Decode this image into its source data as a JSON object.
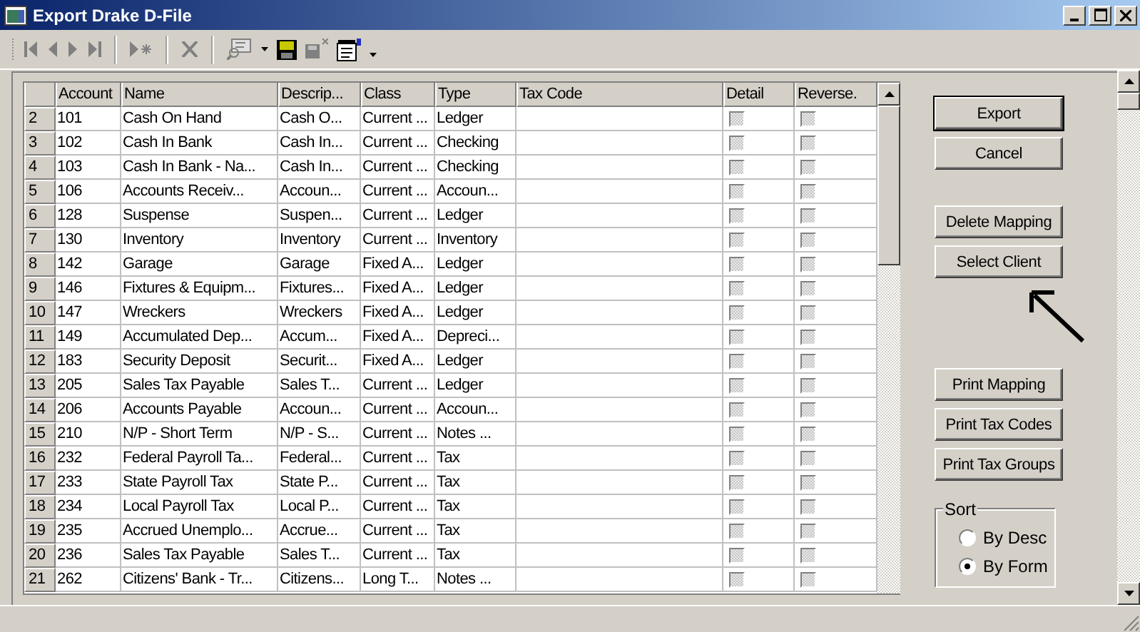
{
  "window": {
    "title": "Export Drake D-File"
  },
  "grid": {
    "columns": [
      "Account",
      "Name",
      "Descrip...",
      "Class",
      "Type",
      "Tax Code",
      "Detail",
      "Reverse."
    ],
    "rows": [
      {
        "num": "2",
        "account": "101",
        "name": "Cash On Hand",
        "description": "Cash O...",
        "class": "Current ...",
        "type": "Ledger",
        "detail": false,
        "reverse": false
      },
      {
        "num": "3",
        "account": "102",
        "name": "Cash In Bank",
        "description": "Cash In...",
        "class": "Current ...",
        "type": "Checking",
        "detail": false,
        "reverse": false
      },
      {
        "num": "4",
        "account": "103",
        "name": "Cash In Bank - Na...",
        "description": "Cash In...",
        "class": "Current ...",
        "type": "Checking",
        "detail": false,
        "reverse": false
      },
      {
        "num": "5",
        "account": "106",
        "name": "Accounts Receiv...",
        "description": "Accoun...",
        "class": "Current ...",
        "type": "Accoun...",
        "detail": false,
        "reverse": false
      },
      {
        "num": "6",
        "account": "128",
        "name": "Suspense",
        "description": "Suspen...",
        "class": "Current ...",
        "type": "Ledger",
        "detail": false,
        "reverse": false
      },
      {
        "num": "7",
        "account": "130",
        "name": "Inventory",
        "description": "Inventory",
        "class": "Current ...",
        "type": "Inventory",
        "detail": false,
        "reverse": false
      },
      {
        "num": "8",
        "account": "142",
        "name": "Garage",
        "description": "Garage",
        "class": "Fixed A...",
        "type": "Ledger",
        "detail": false,
        "reverse": false
      },
      {
        "num": "9",
        "account": "146",
        "name": "Fixtures & Equipm...",
        "description": "Fixtures...",
        "class": "Fixed A...",
        "type": "Ledger",
        "detail": false,
        "reverse": false
      },
      {
        "num": "10",
        "account": "147",
        "name": "Wreckers",
        "description": "Wreckers",
        "class": "Fixed A...",
        "type": "Ledger",
        "detail": false,
        "reverse": false
      },
      {
        "num": "11",
        "account": "149",
        "name": "Accumulated Dep...",
        "description": "Accum...",
        "class": "Fixed A...",
        "type": "Depreci...",
        "detail": false,
        "reverse": false
      },
      {
        "num": "12",
        "account": "183",
        "name": "Security Deposit",
        "description": "Securit...",
        "class": "Fixed A...",
        "type": "Ledger",
        "detail": false,
        "reverse": false
      },
      {
        "num": "13",
        "account": "205",
        "name": "Sales Tax Payable",
        "description": "Sales T...",
        "class": "Current ...",
        "type": "Ledger",
        "detail": false,
        "reverse": false
      },
      {
        "num": "14",
        "account": "206",
        "name": "Accounts Payable",
        "description": "Accoun...",
        "class": "Current ...",
        "type": "Accoun...",
        "detail": false,
        "reverse": false
      },
      {
        "num": "15",
        "account": "210",
        "name": "N/P - Short Term",
        "description": "N/P - S...",
        "class": "Current ...",
        "type": "Notes ...",
        "detail": false,
        "reverse": false
      },
      {
        "num": "16",
        "account": "232",
        "name": "Federal Payroll Ta...",
        "description": "Federal...",
        "class": "Current ...",
        "type": "Tax",
        "detail": false,
        "reverse": false
      },
      {
        "num": "17",
        "account": "233",
        "name": "State Payroll Tax",
        "description": "State P...",
        "class": "Current ...",
        "type": "Tax",
        "detail": false,
        "reverse": false
      },
      {
        "num": "18",
        "account": "234",
        "name": "Local Payroll Tax",
        "description": "Local P...",
        "class": "Current ...",
        "type": "Tax",
        "detail": false,
        "reverse": false
      },
      {
        "num": "19",
        "account": "235",
        "name": "Accrued Unemplo...",
        "description": "Accrue...",
        "class": "Current ...",
        "type": "Tax",
        "detail": false,
        "reverse": false
      },
      {
        "num": "20",
        "account": "236",
        "name": "Sales Tax Payable",
        "description": "Sales T...",
        "class": "Current ...",
        "type": "Tax",
        "detail": false,
        "reverse": false
      },
      {
        "num": "21",
        "account": "262",
        "name": "Citizens' Bank - Tr...",
        "description": "Citizens...",
        "class": "Long T...",
        "type": "Notes ...",
        "detail": false,
        "reverse": false
      }
    ]
  },
  "buttons": [
    {
      "label": "Export",
      "default": true
    },
    {
      "label": "Cancel",
      "default": false
    },
    {
      "label": "Delete Mapping",
      "default": false
    },
    {
      "label": "Select Client",
      "default": false
    },
    {
      "label": "Print Mapping",
      "default": false
    },
    {
      "label": "Print Tax Codes",
      "default": false
    },
    {
      "label": "Print Tax Groups",
      "default": false
    }
  ],
  "sort": {
    "title": "Sort",
    "options": [
      {
        "label": "By Desc",
        "selected": false
      },
      {
        "label": "By Form",
        "selected": true
      }
    ]
  }
}
